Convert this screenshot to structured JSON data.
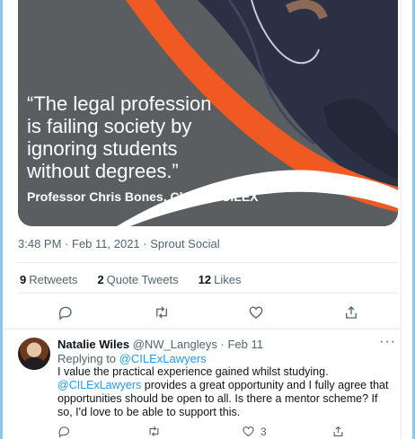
{
  "media": {
    "quote": "“The legal profession\nis failing society by\nignoring students\nwithout degrees.”",
    "attribution": "Professor Chris Bones, Chair of CILEX",
    "colors": {
      "background": "#5b5e61",
      "accent": "#f05a22",
      "stripe": "#ffffff"
    }
  },
  "tweet": {
    "time": "3:48 PM",
    "separator": "·",
    "date": "Feb 11, 2021",
    "source": "Sprout Social",
    "stats": {
      "retweets_count": "9",
      "retweets_label": "Retweets",
      "quotes_count": "2",
      "quotes_label": "Quote Tweets",
      "likes_count": "12",
      "likes_label": "Likes"
    },
    "actions": [
      "reply-icon",
      "retweet-icon",
      "like-icon",
      "share-icon"
    ]
  },
  "reply": {
    "name": "Natalie Wiles",
    "handle": "@NW_Langleys",
    "separator": "·",
    "date": "Feb 11",
    "more": "···",
    "replying_to_label": "Replying to",
    "replying_to_handle": "@CILExLawyers",
    "body_part1": "I  value the practical experience gained whilst studying.  ",
    "body_mention": "@CILExLawyers",
    "body_part2": " provides a great opportunity and I fully agree that opportunities should be open to all.   Is there a mentor scheme? If so, I'd love to be able to support this.",
    "likes_count": "3"
  },
  "colors": {
    "link": "#1d9bf0",
    "muted": "#536471",
    "text": "#0f1419",
    "frame": "#8fc7ea"
  }
}
